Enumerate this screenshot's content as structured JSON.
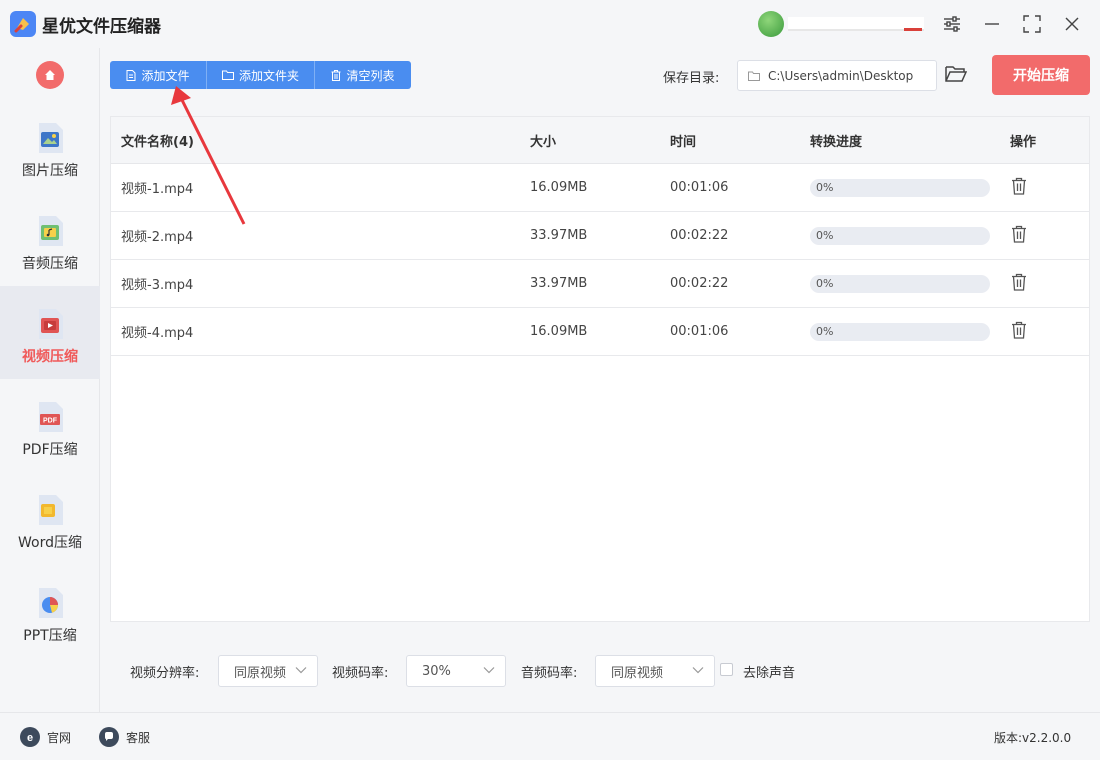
{
  "app": {
    "title": "星优文件压缩器"
  },
  "window": {
    "settings_icon": "sliders-icon",
    "minimize_icon": "minimize-icon",
    "maximize_icon": "maximize-icon",
    "close_icon": "close-icon"
  },
  "sidebar": {
    "home_icon": "home-icon",
    "items": [
      {
        "label": "图片压缩",
        "icon": "image-icon"
      },
      {
        "label": "音频压缩",
        "icon": "audio-icon"
      },
      {
        "label": "视频压缩",
        "icon": "video-icon",
        "active": true
      },
      {
        "label": "PDF压缩",
        "icon": "pdf-icon"
      },
      {
        "label": "Word压缩",
        "icon": "word-icon"
      },
      {
        "label": "PPT压缩",
        "icon": "ppt-icon"
      }
    ]
  },
  "toolbar": {
    "add_file": "添加文件",
    "add_folder": "添加文件夹",
    "clear_list": "清空列表",
    "save_dir_label": "保存目录:",
    "save_dir_value": "C:\\Users\\admin\\Desktop",
    "start_button": "开始压缩"
  },
  "table": {
    "headers": {
      "name": "文件名称(4)",
      "size": "大小",
      "time": "时间",
      "progress": "转换进度",
      "action": "操作"
    },
    "rows": [
      {
        "name": "视频-1.mp4",
        "size": "16.09MB",
        "time": "00:01:06",
        "progress": "0%"
      },
      {
        "name": "视频-2.mp4",
        "size": "33.97MB",
        "time": "00:02:22",
        "progress": "0%"
      },
      {
        "name": "视频-3.mp4",
        "size": "33.97MB",
        "time": "00:02:22",
        "progress": "0%"
      },
      {
        "name": "视频-4.mp4",
        "size": "16.09MB",
        "time": "00:01:06",
        "progress": "0%"
      }
    ]
  },
  "options": {
    "resolution_label": "视频分辨率:",
    "resolution_value": "同原视频",
    "video_bitrate_label": "视频码率:",
    "video_bitrate_value": "30%",
    "audio_bitrate_label": "音频码率:",
    "audio_bitrate_value": "同原视频",
    "remove_audio_label": "去除声音"
  },
  "status": {
    "website": "官网",
    "service": "客服",
    "version": "版本:v2.2.0.0"
  },
  "colors": {
    "accent_blue": "#4a8df0",
    "accent_red": "#f26b6b",
    "annotation_arrow": "#e8383d"
  }
}
